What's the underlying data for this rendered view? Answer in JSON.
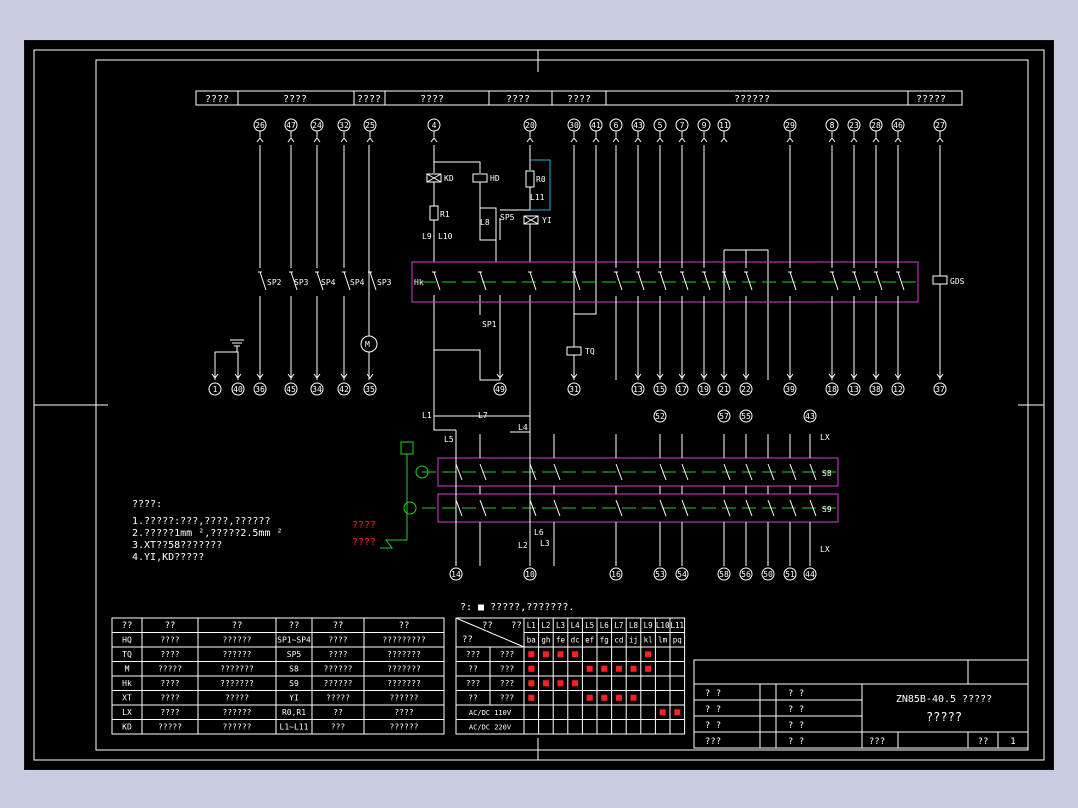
{
  "header": {
    "cells": [
      "????",
      "????",
      "????",
      "????",
      "????",
      "????",
      "??????",
      "?????"
    ]
  },
  "top_terminals": [
    "26",
    "47",
    "24",
    "32",
    "25",
    "4",
    "20",
    "30",
    "41",
    "6",
    "43",
    "5",
    "7",
    "9",
    "11",
    "29",
    "8",
    "23",
    "28",
    "46",
    "27"
  ],
  "bottom_terminals": [
    "1",
    "40",
    "36",
    "45",
    "34",
    "42",
    "35",
    "49",
    "31",
    "13",
    "15",
    "17",
    "19",
    "21",
    "22",
    "39",
    "18",
    "13",
    "38",
    "12",
    "37"
  ],
  "lower_top_terminals": [
    "52",
    "57",
    "55",
    "43"
  ],
  "lower_bottom_terminals": [
    "14",
    "10",
    "16",
    "53",
    "54",
    "58",
    "56",
    "50",
    "51",
    "44"
  ],
  "components": {
    "kd": "KD",
    "hd": "HD",
    "r0": "R0",
    "r1": "R1",
    "l9": "L9",
    "l10": "L10",
    "l8": "L8",
    "l11": "L11",
    "sp5": "SP5",
    "yi": "YI",
    "tq": "TQ",
    "hk": "Hk",
    "gds": "GDS",
    "sp1": "SP1",
    "sp2": "SP2",
    "sp3a": "SP3",
    "sp4a": "SP4",
    "sp4b": "SP4",
    "sp3b": "SP3",
    "motor": "M",
    "sb": "S8",
    "s9": "S9",
    "lx1": "LX",
    "lx2": "LX",
    "l1": "L1",
    "l7": "L7",
    "l4": "L4",
    "l5": "L5",
    "l2": "L2",
    "l3": "L3",
    "l6": "L6"
  },
  "notes": {
    "title": "????:",
    "lines": [
      "1.?????:???,????,??????",
      "2.?????1mm ²,?????2.5mm ²",
      "3.XT??58???????",
      "4.YI,KD?????"
    ],
    "red1": "????",
    "red2": "????"
  },
  "legend_note": "?: ■  ?????,???????.",
  "component_table": {
    "headers": [
      "??",
      "??",
      "??",
      "??",
      "??",
      "??"
    ],
    "rows": [
      [
        "HQ",
        "????",
        "??????",
        "SP1~SP4",
        "????",
        "?????????"
      ],
      [
        "TQ",
        "????",
        "??????",
        "SP5",
        "????",
        "???????"
      ],
      [
        "M",
        "?????",
        "???????",
        "S8",
        "??????",
        "???????"
      ],
      [
        "Hk",
        "????",
        "???????",
        "S9",
        "??????",
        "???????"
      ],
      [
        "XT",
        "????",
        "?????",
        "YI",
        "?????",
        "??????"
      ],
      [
        "LX",
        "????",
        "??????",
        "R0,R1",
        "??",
        "????"
      ],
      [
        "KD",
        "?????",
        "??????",
        "L1~L11",
        "???",
        "??????"
      ]
    ]
  },
  "wire_table": {
    "corner_top": "??",
    "corner_right": "??",
    "corner_left": "??",
    "wires": [
      "L1",
      "L2",
      "L3",
      "L4",
      "L5",
      "L6",
      "L7",
      "L8",
      "L9",
      "L10",
      "L11"
    ],
    "pairs": [
      "ba",
      "gh",
      "fe",
      "dc",
      "ef",
      "fg",
      "cd",
      "ij",
      "kl",
      "lm",
      "pq"
    ],
    "row_groups": [
      {
        "label": "???",
        "sub": "???"
      },
      {
        "label": "??",
        "sub": "???"
      },
      {
        "label": "???",
        "sub": "???"
      },
      {
        "label": "??",
        "sub": "???"
      }
    ],
    "ac_rows": [
      "AC/DC 110V",
      "AC/DC 220V"
    ],
    "marks": [
      [
        1,
        1,
        1,
        1,
        0,
        0,
        0,
        0,
        1,
        0,
        0
      ],
      [
        1,
        0,
        0,
        0,
        1,
        1,
        1,
        1,
        1,
        0,
        0
      ],
      [
        1,
        1,
        1,
        1,
        0,
        0,
        0,
        0,
        0,
        0,
        0
      ],
      [
        1,
        0,
        0,
        0,
        1,
        1,
        1,
        1,
        0,
        0,
        0
      ],
      [
        0,
        0,
        0,
        0,
        0,
        0,
        0,
        0,
        0,
        1,
        1
      ],
      [
        0,
        0,
        0,
        0,
        0,
        0,
        0,
        0,
        0,
        0,
        0
      ]
    ]
  },
  "title_block": {
    "title1": "ZN85B-40.5 ?????",
    "title2": "?????",
    "rows": [
      [
        "? ?",
        "? ?"
      ],
      [
        "? ?",
        "? ?"
      ],
      [
        "? ?",
        "? ?"
      ],
      [
        "???",
        "? ?"
      ]
    ],
    "scale_label": "???",
    "sheet_label": "??",
    "sheet_no": "1"
  }
}
